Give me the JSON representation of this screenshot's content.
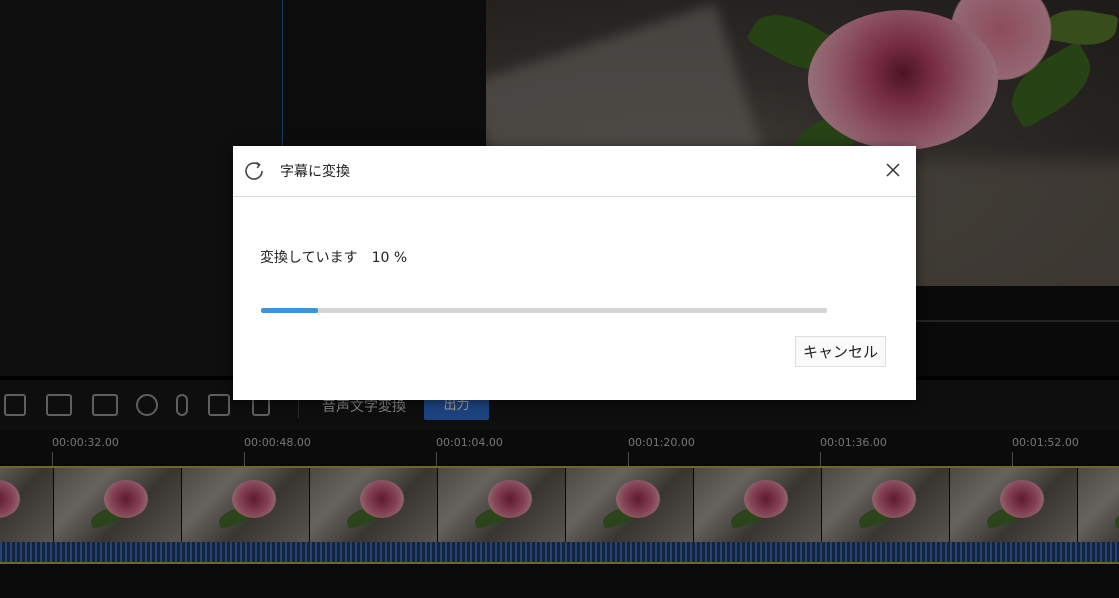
{
  "dialog": {
    "title": "字幕に変換",
    "status_text": "変換しています",
    "progress_percent": "10 %",
    "progress_value": 0.1,
    "cancel_label": "キャンセル"
  },
  "toolbar": {
    "speech_to_text_label": "音声文字変換",
    "export_label": "出力"
  },
  "timeline": {
    "timecodes": [
      "00:00:32.00",
      "00:00:48.00",
      "00:01:04.00",
      "00:01:20.00",
      "00:01:36.00",
      "00:01:52.00"
    ]
  },
  "colors": {
    "accent": "#3c93e0",
    "track_border": "#b9a246",
    "audio_wave": "#3f6fba"
  }
}
